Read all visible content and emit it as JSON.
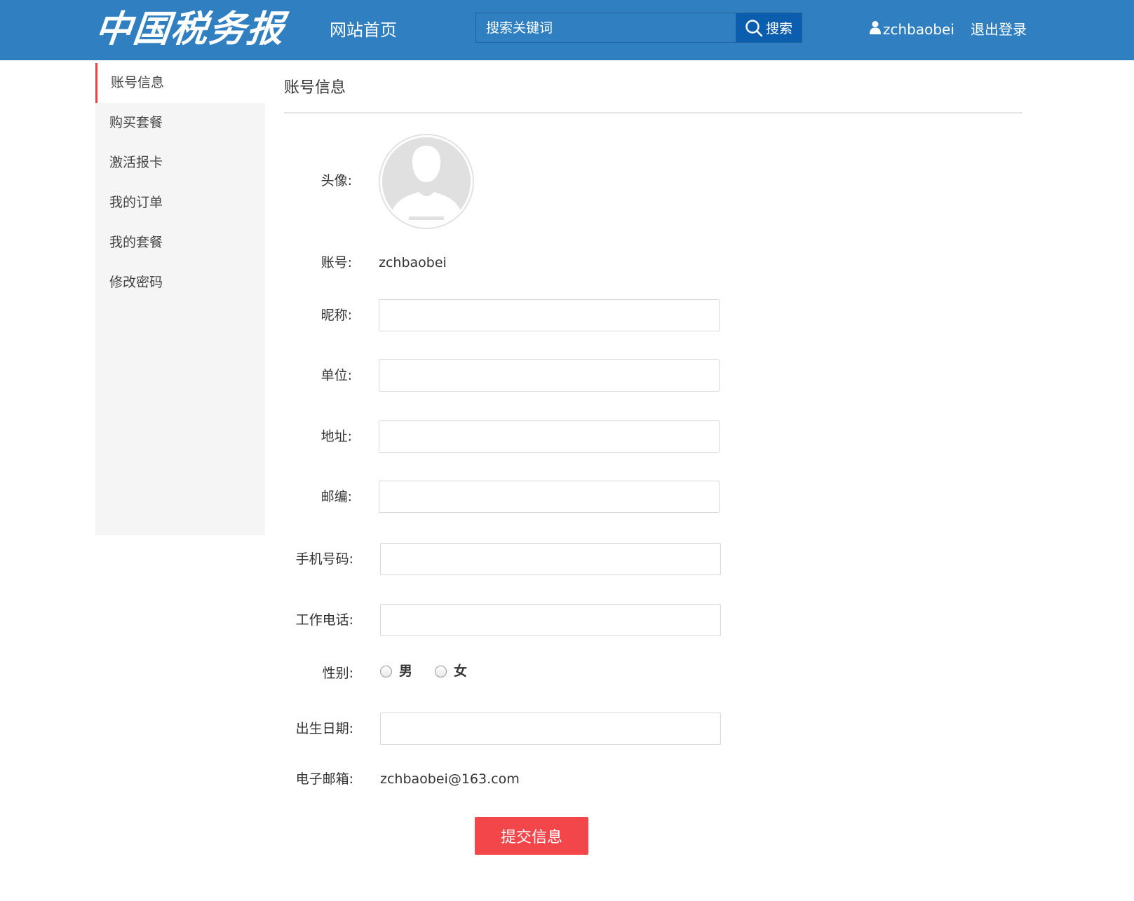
{
  "header": {
    "logo_text": "中国税务报",
    "nav_home": "网站首页",
    "search": {
      "placeholder": "搜索关键词",
      "button_label": "搜索"
    },
    "username": "zchbaobei",
    "logout": "退出登录"
  },
  "sidebar": {
    "items": [
      {
        "label": "账号信息"
      },
      {
        "label": "购买套餐"
      },
      {
        "label": "激活报卡"
      },
      {
        "label": "我的订单"
      },
      {
        "label": "我的套餐"
      },
      {
        "label": "修改密码"
      }
    ]
  },
  "main": {
    "title": "账号信息",
    "avatar_label": "头像:",
    "account": {
      "label": "账号:",
      "value": "zchbaobei"
    },
    "nickname": {
      "label": "昵称:",
      "value": ""
    },
    "unit": {
      "label": "单位:",
      "value": ""
    },
    "address": {
      "label": "地址:",
      "value": ""
    },
    "postcode": {
      "label": "邮编:",
      "value": ""
    },
    "mobile": {
      "label": "手机号码:",
      "value": ""
    },
    "work_phone": {
      "label": "工作电话:",
      "value": ""
    },
    "gender": {
      "label": "性别:",
      "options": [
        {
          "label": "男",
          "checked": false
        },
        {
          "label": "女",
          "checked": false
        }
      ]
    },
    "birthday": {
      "label": "出生日期:",
      "value": ""
    },
    "email": {
      "label": "电子邮箱:",
      "value": "zchbaobei@163.com"
    },
    "submit_label": "提交信息"
  },
  "colors": {
    "header_bg": "#2f7fc1",
    "search_button_bg": "#0b5dae",
    "active_accent": "#e84548",
    "submit_bg": "#f2464b",
    "sidebar_bg": "#f5f5f5"
  },
  "icons": {
    "search": "search-icon",
    "user": "user-icon",
    "avatar": "avatar-placeholder-icon"
  }
}
